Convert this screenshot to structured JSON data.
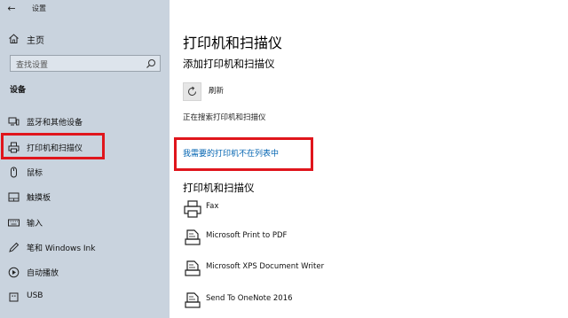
{
  "window": {
    "back_glyph": "←",
    "app_title": "设置"
  },
  "sidebar": {
    "home_label": "主页",
    "search": {
      "placeholder": "查找设置",
      "icon": "search-icon"
    },
    "section_title": "设备",
    "items": [
      {
        "label": "蓝牙和其他设备",
        "icon": "bluetooth-devices-icon",
        "selected": false
      },
      {
        "label": "打印机和扫描仪",
        "icon": "printer-icon",
        "selected": true
      },
      {
        "label": "鼠标",
        "icon": "mouse-icon",
        "selected": false
      },
      {
        "label": "触摸板",
        "icon": "touchpad-icon",
        "selected": false
      },
      {
        "label": "输入",
        "icon": "keyboard-icon",
        "selected": false
      },
      {
        "label": "笔和 Windows Ink",
        "icon": "pen-icon",
        "selected": false
      },
      {
        "label": "自动播放",
        "icon": "autoplay-icon",
        "selected": false
      },
      {
        "label": "USB",
        "icon": "usb-icon",
        "selected": false
      }
    ]
  },
  "main": {
    "page_title": "打印机和扫描仪",
    "add_section_title": "添加打印机和扫描仪",
    "refresh_label": "刷新",
    "searching_text": "正在搜索打印机和扫描仪",
    "missing_printer_link": "我需要的打印机不在列表中",
    "printers_section_title": "打印机和扫描仪",
    "printers": [
      {
        "name": "Fax",
        "icon": "fax-printer-icon"
      },
      {
        "name": "Microsoft Print to PDF",
        "icon": "document-printer-icon"
      },
      {
        "name": "Microsoft XPS Document Writer",
        "icon": "document-printer-icon"
      },
      {
        "name": "Send To OneNote 2016",
        "icon": "document-printer-icon"
      }
    ]
  },
  "colors": {
    "sidebar_bg": "#c9d3de",
    "highlight_red": "#e0151c",
    "link_blue": "#0063b1"
  }
}
